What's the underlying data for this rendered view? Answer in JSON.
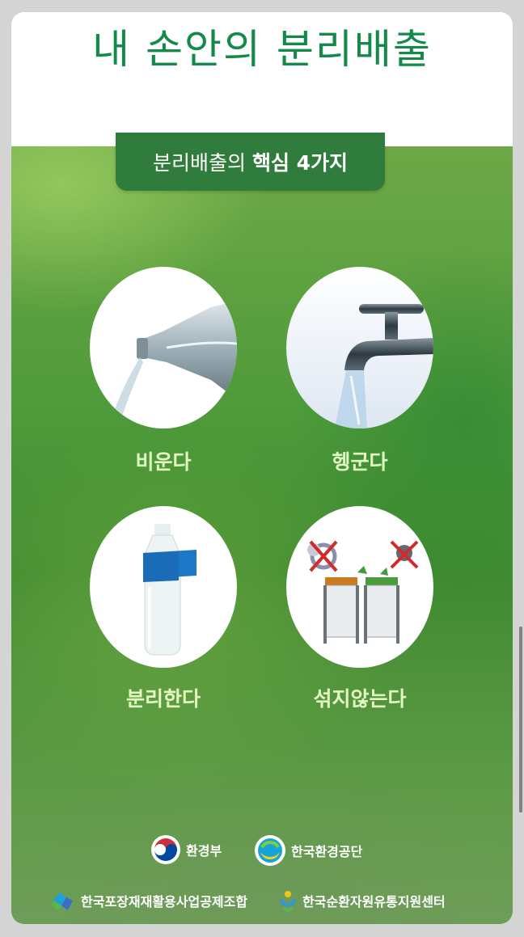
{
  "title": "내 손안의 분리배출",
  "banner": {
    "prefix": "분리배출의",
    "emphasis": "핵심 4가지"
  },
  "steps": [
    {
      "label": "비운다",
      "icon": "pouring-bottle-icon"
    },
    {
      "label": "헹군다",
      "icon": "water-faucet-icon"
    },
    {
      "label": "분리한다",
      "icon": "bottle-label-icon"
    },
    {
      "label": "섞지않는다",
      "icon": "separate-bins-icon"
    }
  ],
  "logos": {
    "moe": "환경부",
    "keco": "한국환경공단",
    "kprc": "한국포장재재활용사업공제조합",
    "korc": "한국순환자원유통지원센터"
  },
  "colors": {
    "title_green": "#138a4a",
    "banner_green": "#2f7c3c",
    "label_color": "#e3f7c3"
  }
}
